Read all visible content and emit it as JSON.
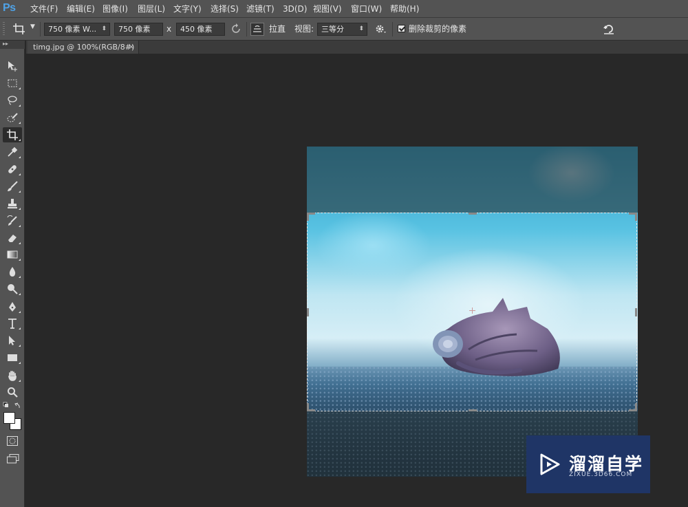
{
  "app": {
    "logo": "Ps"
  },
  "menu": [
    "文件(F)",
    "编辑(E)",
    "图像(I)",
    "图层(L)",
    "文字(Y)",
    "选择(S)",
    "滤镜(T)",
    "3D(D)",
    "视图(V)",
    "窗口(W)",
    "帮助(H)"
  ],
  "options": {
    "ratio_preset": "750 像素 W...",
    "width": "750 像素",
    "times": "x",
    "height": "450 像素",
    "straighten_label": "拉直",
    "view_label": "视图:",
    "view_value": "三等分",
    "delete_cropped_label": "删除裁剪的像素",
    "delete_cropped_checked": true
  },
  "document": {
    "tab_title": "timg.jpg @ 100%(RGB/8#)",
    "close_glyph": "×"
  },
  "toolbox": {
    "head": "▸▸"
  },
  "watermark": {
    "name": "溜溜自学",
    "url": "ZIXUE.3D66.COM"
  },
  "colors": {
    "panel": "#535353",
    "workspace": "#282828",
    "ps_blue": "#4fa3e8",
    "watermark_bg": "#1f3566"
  }
}
